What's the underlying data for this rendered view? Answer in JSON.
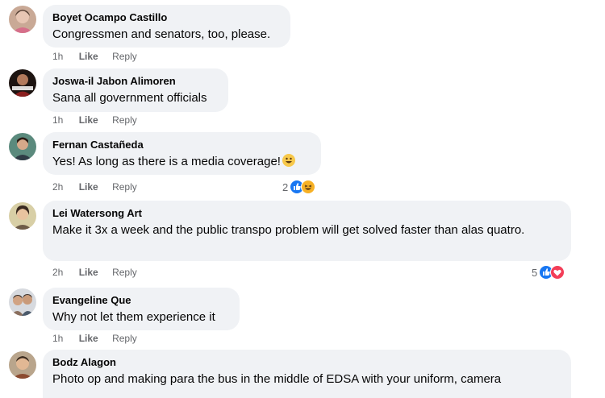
{
  "actions": {
    "like": "Like",
    "reply": "Reply"
  },
  "comments": [
    {
      "author": "Boyet Ocampo Castillo",
      "text": "Congressmen and senators, too, please.",
      "time": "1h"
    },
    {
      "author": "Joswa-il Jabon Alimoren",
      "text": "Sana all government officials",
      "time": "1h"
    },
    {
      "author": "Fernan Castañeda",
      "text": "Yes! As long as there is a media coverage!",
      "time": "2h",
      "reaction_count": "2",
      "reactions": [
        "like-icon",
        "haha-icon"
      ],
      "emoji": "grinning-face-icon"
    },
    {
      "author": "Lei Watersong Art",
      "text": "Make it 3x a week and the public transpo problem will get solved faster than alas quatro.",
      "time": "2h",
      "reaction_count": "5",
      "reactions": [
        "like-icon",
        "love-icon"
      ]
    },
    {
      "author": "Evangeline Que",
      "text": "Why not let them experience it",
      "time": "1h"
    },
    {
      "author": "Bodz Alagon",
      "text": "Photo op and making para the bus in the middle of EDSA with your uniform, camera"
    }
  ],
  "colors": {
    "bubble": "#f0f2f5",
    "meta_text": "#65676b",
    "like_blue": "#1877f2",
    "love_red": "#f33e58",
    "haha_yellow": "#f7b125"
  }
}
